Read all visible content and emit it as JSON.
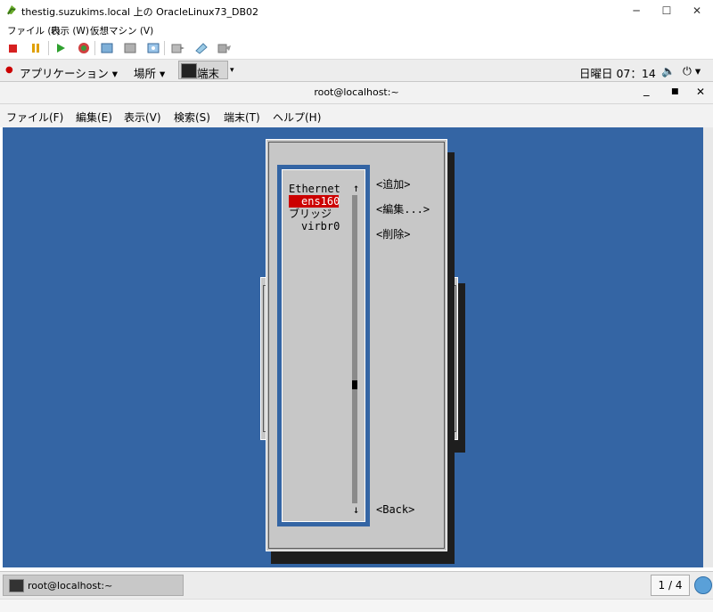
{
  "window": {
    "title": "thestig.suzukims.local 上の OracleLinux73_DB02",
    "minimize": "─",
    "maximize": "☐",
    "close": "✕"
  },
  "vm_menu": {
    "file": "ファイル (F)",
    "view": "表示 (W)",
    "vm": "仮想マシン (V)"
  },
  "gnome": {
    "applications": "アプリケーション",
    "places": "場所",
    "terminal": "端末",
    "clock": "日曜日 07：14"
  },
  "terminal": {
    "title": "root@localhost:~",
    "menu": [
      "ファイル(F)",
      "編集(E)",
      "表示(V)",
      "検索(S)",
      "端末(T)",
      "ヘルプ(H)"
    ]
  },
  "nmtui": {
    "list_items": [
      "Ethernet",
      "ens160",
      "ブリッジ",
      "virbr0"
    ],
    "selected_index": 1,
    "scroll_up": "↑",
    "scroll_down": "↓",
    "buttons": {
      "add": "<追加>",
      "edit": "<編集...>",
      "delete": "<削除>",
      "back": "<Back>"
    }
  },
  "taskbar": {
    "item": "root@localhost:~",
    "pager": "1 / 4"
  },
  "colors": {
    "terminal_bg": "#3465a4",
    "dialog_bg": "#c7c7c7",
    "selection": "#cc0000"
  }
}
